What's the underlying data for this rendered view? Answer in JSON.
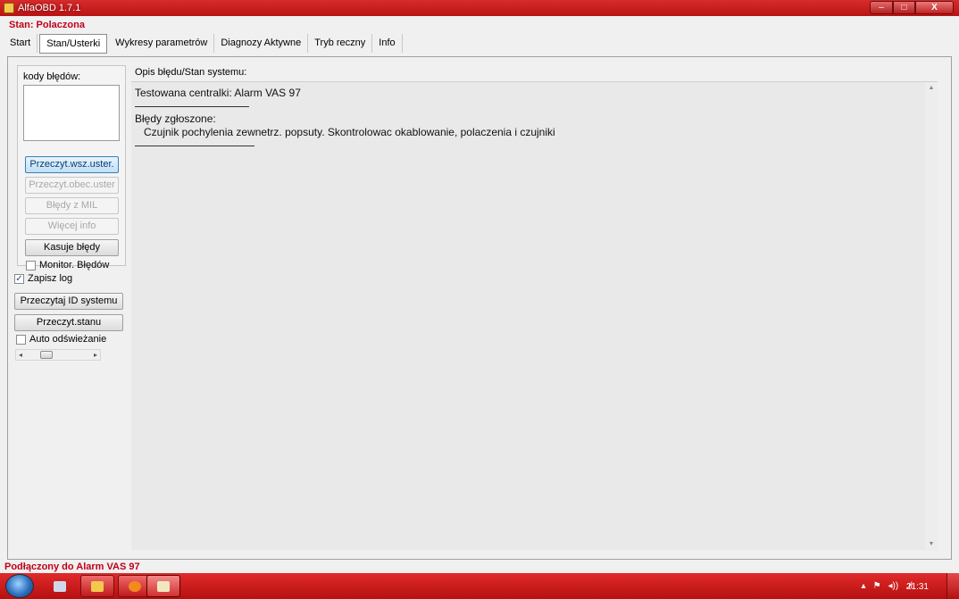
{
  "window": {
    "title": "AlfaOBD 1.7.1",
    "min": "–",
    "max": "□",
    "close": "X"
  },
  "status_top": "Stan: Polaczona",
  "tabs": [
    {
      "label": "Start"
    },
    {
      "label": "Stan/Usterki"
    },
    {
      "label": "Wykresy parametrów"
    },
    {
      "label": "Diagnozy Aktywne"
    },
    {
      "label": "Tryb reczny"
    },
    {
      "label": "Info"
    }
  ],
  "left": {
    "codes_label": "kody błędów:",
    "btn_read_all": "Przeczyt.wsz.uster.",
    "btn_read_current": "Przeczyt.obec.uster",
    "btn_mil_errors": "Błędy z MIL",
    "btn_more_info": "Więcej info",
    "btn_clear_errors": "Kasuje błędy",
    "cb_monitor_errors": "Monitor. Błędów",
    "cb_save_log": "Zapisz log",
    "btn_read_system_id": "Przeczytaj ID systemu",
    "btn_read_state": "Przeczyt.stanu",
    "cb_auto_refresh": "Auto odświeżanie"
  },
  "description": {
    "label": "Opis błędu/Stan systemu:",
    "tested_unit": "Testowana centralki: Alarm VAS 97",
    "reported_errors_label": "Błędy zgłoszone:",
    "reported_errors_text": "   Czujnik pochylenia zewnetrz. popsuty. Skontrolowac okablowanie, polaczenia i czujniki"
  },
  "status_bottom": "Podłączony do Alarm VAS 97",
  "taskbar": {
    "clock": "21:31",
    "tray_arrow": "▴",
    "tray_flag": "⚑",
    "tray_volume": "◂))",
    "tray_signal": ".ıl"
  }
}
